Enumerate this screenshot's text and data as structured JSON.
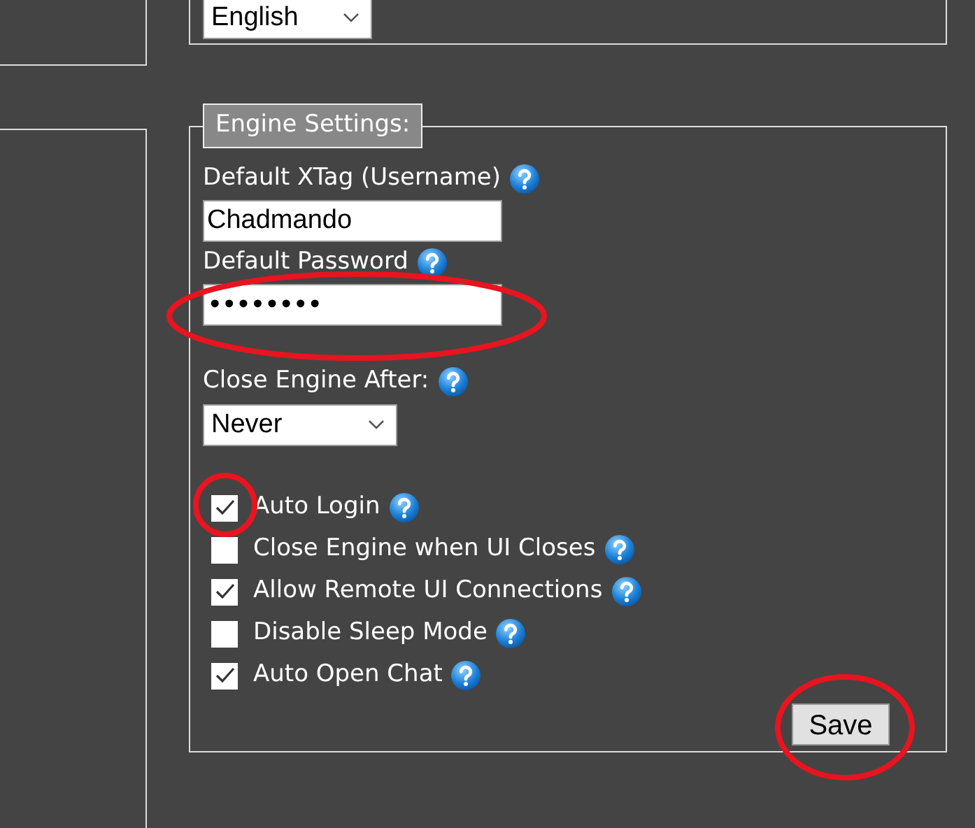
{
  "language_select": {
    "value": "English"
  },
  "engine_settings": {
    "legend": "Engine Settings:",
    "username": {
      "label": "Default XTag (Username)",
      "value": "Chadmando"
    },
    "password": {
      "label": "Default Password",
      "value": "••••••••"
    },
    "close_after": {
      "label": "Close Engine After:",
      "value": "Never"
    },
    "options": [
      {
        "label": "Auto Login",
        "checked": true
      },
      {
        "label": "Close Engine when UI Closes",
        "checked": false
      },
      {
        "label": "Allow Remote UI Connections",
        "checked": true
      },
      {
        "label": "Disable Sleep Mode",
        "checked": false
      },
      {
        "label": "Auto Open Chat",
        "checked": true
      }
    ],
    "save_button": "Save"
  }
}
